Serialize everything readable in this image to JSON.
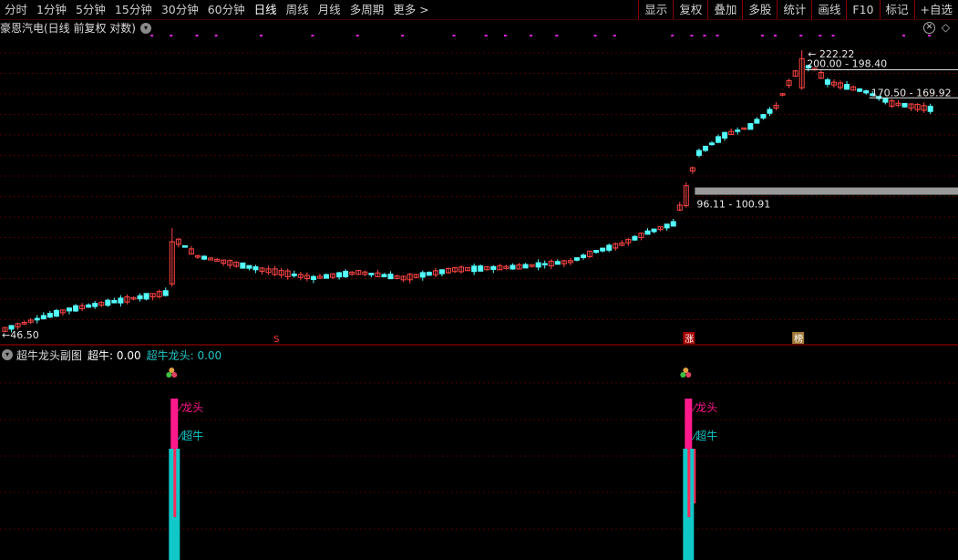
{
  "toolbar": {
    "periods": [
      "分时",
      "1分钟",
      "5分钟",
      "15分钟",
      "30分钟",
      "60分钟",
      "日线",
      "周线",
      "月线",
      "多周期",
      "更多 >"
    ],
    "active_period": "日线",
    "tools": [
      "显示",
      "复权",
      "叠加",
      "多股",
      "统计",
      "画线",
      "F10",
      "标记",
      "+自选"
    ]
  },
  "chart": {
    "title": "豪恩汽电(日线 前复权 对数)",
    "high_label": "222.22",
    "low_label": "46.50",
    "zones": [
      {
        "label": "200.00 - 198.40"
      },
      {
        "label": "170.50 - 169.92"
      },
      {
        "label": "96.11 - 100.91"
      }
    ],
    "markers": [
      {
        "text": "S",
        "bar": 42,
        "color": "#ff3c3c",
        "bg": "none"
      },
      {
        "text": "涨",
        "bar": 106,
        "color": "#ffffff",
        "bg": "#a80000"
      },
      {
        "text": "榜",
        "bar": 123,
        "color": "#ffffff",
        "bg": "#a07a3a"
      }
    ],
    "bar_count": 145,
    "price_range": [
      44.0,
      240.0
    ],
    "up_color": "#ff4646",
    "down_color": "#54ffff",
    "signal_color": "#e020e0"
  },
  "indicator": {
    "name": "超牛龙头副图",
    "value1_label": "超牛: 0.00",
    "value2_label": "超牛龙头: 0.00",
    "tag_long": "龙头",
    "tag_bull": "超牛",
    "signals": [
      {
        "bar": 26
      },
      {
        "bar": 106
      }
    ],
    "colors": {
      "long": "#ff1a8c",
      "bull": "#10c8c8"
    }
  },
  "icons": {
    "toggle": "chevron-down-icon",
    "close": "close-icon",
    "config": "settings-icon",
    "signal": "three-balls-icon"
  }
}
